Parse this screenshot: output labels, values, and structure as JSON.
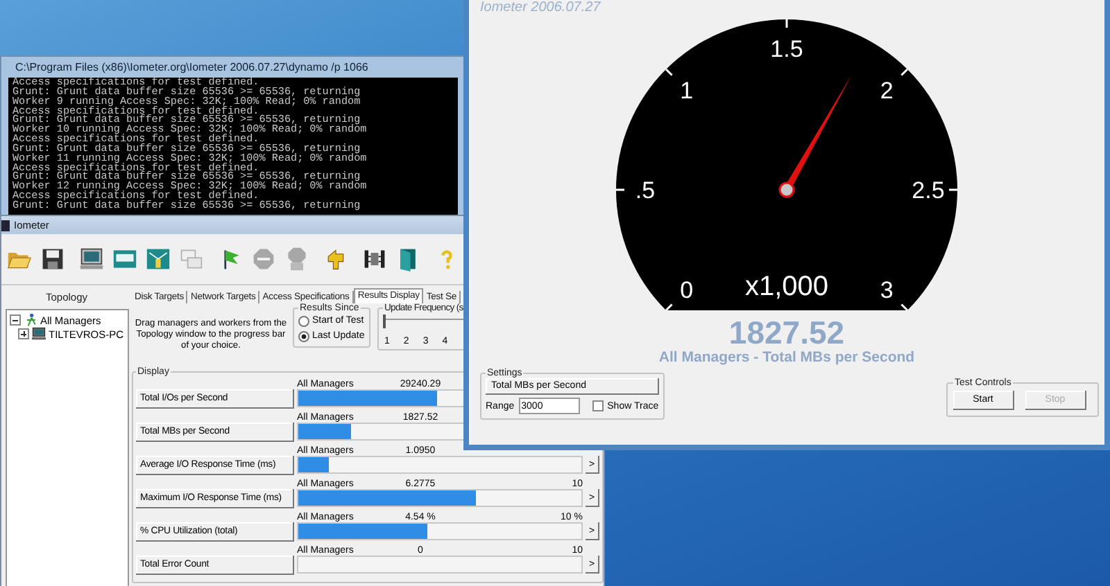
{
  "console_window": {
    "title": "C:\\Program Files (x86)\\Iometer.org\\Iometer 2006.07.27\\dynamo /p 1066",
    "lines": [
      "Access specifications for test defined.",
      "Grunt: Grunt data buffer size 65536 >= 65536, returning",
      "Worker 9 running Access Spec: 32K; 100% Read; 0% random",
      "Access specifications for test defined.",
      "Grunt: Grunt data buffer size 65536 >= 65536, returning",
      "Worker 10 running Access Spec: 32K; 100% Read; 0% random",
      "Access specifications for test defined.",
      "Grunt: Grunt data buffer size 65536 >= 65536, returning",
      "Worker 11 running Access Spec: 32K; 100% Read; 0% random",
      "Access specifications for test defined.",
      "Grunt: Grunt data buffer size 65536 >= 65536, returning",
      "Worker 12 running Access Spec: 32K; 100% Read; 0% random",
      "Access specifications for test defined.",
      "Grunt: Grunt data buffer size 65536 >= 65536, returning"
    ]
  },
  "main_window": {
    "title": "Iometer",
    "toolbar": [
      [
        {
          "disabled": false
        },
        {
          "disabled": false
        }
      ],
      [
        {
          "disabled": false
        },
        {
          "disabled": false
        },
        {
          "disabled": false
        },
        {
          "disabled": true
        }
      ],
      [
        {
          "disabled": false
        },
        {
          "disabled": true
        },
        {
          "disabled": true
        }
      ],
      [
        {
          "disabled": false
        }
      ],
      [
        {
          "disabled": false
        },
        {
          "disabled": false
        }
      ],
      [
        {
          "disabled": false
        }
      ]
    ],
    "topology": {
      "header": "Topology",
      "tree": [
        {
          "label": "All Managers",
          "expanded": true,
          "children": [
            {
              "label": "TILTEVROS-PC",
              "expanded": false
            }
          ]
        }
      ]
    },
    "tabs": [
      {
        "label": "Disk Targets",
        "selected": false
      },
      {
        "label": "Network Targets",
        "selected": false
      },
      {
        "label": "Access Specifications",
        "selected": false
      },
      {
        "label": "Results Display",
        "selected": true
      },
      {
        "label": "Test Se",
        "selected": false
      }
    ],
    "hint": "Drag managers and workers from the Topology window to the progress bar of your choice.",
    "results_since": {
      "title": "Results Since",
      "options": [
        {
          "label": "Start of Test",
          "selected": false
        },
        {
          "label": "Last Update",
          "selected": true
        }
      ]
    },
    "update_frequency": {
      "title": "Update Frequency (s",
      "ticks": [
        "1",
        "2",
        "3",
        "4"
      ],
      "level": 0
    },
    "display": {
      "title": "Display",
      "rows": [
        {
          "metric": "Total I/Os per Second",
          "target": "All Managers",
          "value": "29240.29",
          "level": 0.49
        },
        {
          "metric": "Total MBs per Second",
          "target": "All Managers",
          "value": "1827.52",
          "level": 0.185
        },
        {
          "metric": "Average I/O Response Time (ms)",
          "target": "All Managers",
          "value": "1.0950",
          "level": 0.11,
          "button_label": ">"
        },
        {
          "metric": "Maximum I/O Response Time (ms)",
          "target": "All Managers",
          "value": "6.2775",
          "max": "10",
          "level": 0.628,
          "button_label": ">"
        },
        {
          "metric": "% CPU Utilization (total)",
          "target": "All Managers",
          "value": "4.54 %",
          "max": "10 %",
          "level": 0.454,
          "button_label": ">"
        },
        {
          "metric": "Total Error Count",
          "target": "All Managers",
          "value": "0",
          "max": "10",
          "level": 0,
          "button_label": ">"
        }
      ]
    }
  },
  "meter_window": {
    "title": "Iometer 2006.07.27",
    "gauge": {
      "scale_labels": [
        "0",
        ".5",
        "1",
        "1.5",
        "2",
        "2.5",
        "3"
      ],
      "multiplier": "x1,000",
      "level": 0.609
    },
    "reading": "1827.52",
    "caption": "All Managers - Total MBs per Second",
    "settings": {
      "title": "Settings",
      "metric_button": "Total MBs per Second",
      "range_label": "Range",
      "range_value": "3000",
      "show_trace": {
        "label": "Show Trace",
        "checked": false
      }
    },
    "test_controls": {
      "title": "Test Controls",
      "buttons": [
        {
          "label": "Start",
          "disabled": false
        },
        {
          "label": "Stop",
          "disabled": true
        }
      ]
    }
  }
}
